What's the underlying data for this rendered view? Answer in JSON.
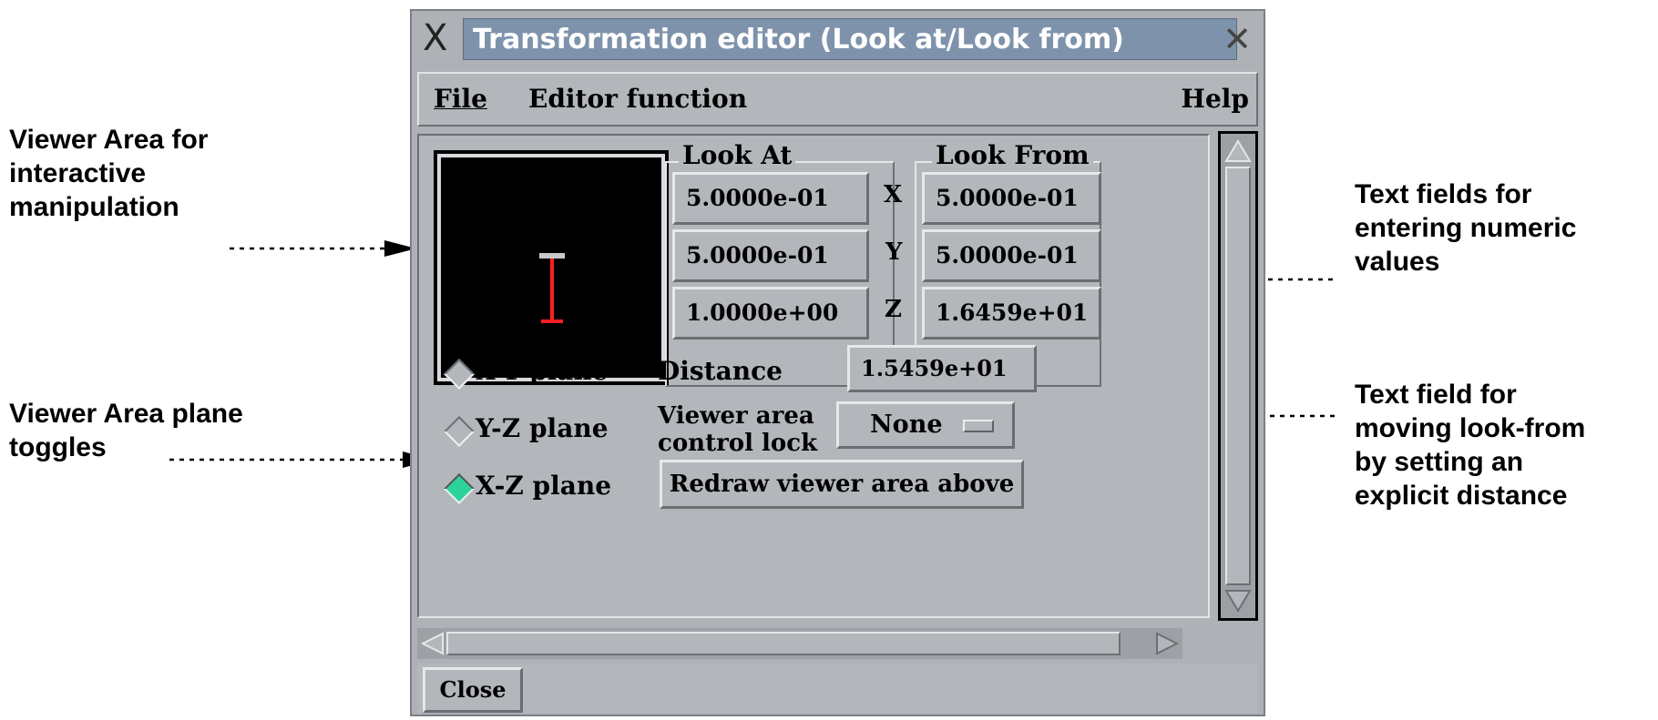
{
  "window": {
    "title": "Transformation editor (Look at/Look from)",
    "close_glyph": "✕",
    "logo_glyph": "X"
  },
  "menubar": {
    "file": "File",
    "editor_function": "Editor function",
    "help": "Help"
  },
  "look_at": {
    "label": "Look At",
    "x": "5.0000e-01",
    "y": "5.0000e-01",
    "z": "1.0000e+00"
  },
  "look_from": {
    "label": "Look From",
    "x": "5.0000e-01",
    "y": "5.0000e-01",
    "z": "1.6459e+01"
  },
  "axes": {
    "x": "X",
    "y": "Y",
    "z": "Z"
  },
  "planes": {
    "xy": "X-Y plane",
    "yz": "Y-Z plane",
    "xz": "X-Z plane",
    "selected": "X-Z plane"
  },
  "distance": {
    "label": "Distance",
    "value": "1.5459e+01"
  },
  "control_lock": {
    "label_line1": "Viewer area",
    "label_line2": "control lock",
    "value": "None"
  },
  "redraw_button": "Redraw viewer area above",
  "close_button": "Close",
  "annotations": {
    "viewer_area_l1": "Viewer Area for",
    "viewer_area_l2": "interactive",
    "viewer_area_l3": "manipulation",
    "plane_toggles_l1": "Viewer Area plane",
    "plane_toggles_l2": "toggles",
    "text_fields_l1": "Text fields for",
    "text_fields_l2": "entering numeric",
    "text_fields_l3": "values",
    "distance_field_l1": "Text field for",
    "distance_field_l2": "moving look-from",
    "distance_field_l3": "by setting an",
    "distance_field_l4": "explicit distance"
  },
  "colors": {
    "title_bar": "#7e93ab",
    "panel": "#b3b6ba",
    "viewer_bg": "#000000",
    "viewer_line": "#ff2020",
    "toggle_on": "#2ed39a"
  }
}
